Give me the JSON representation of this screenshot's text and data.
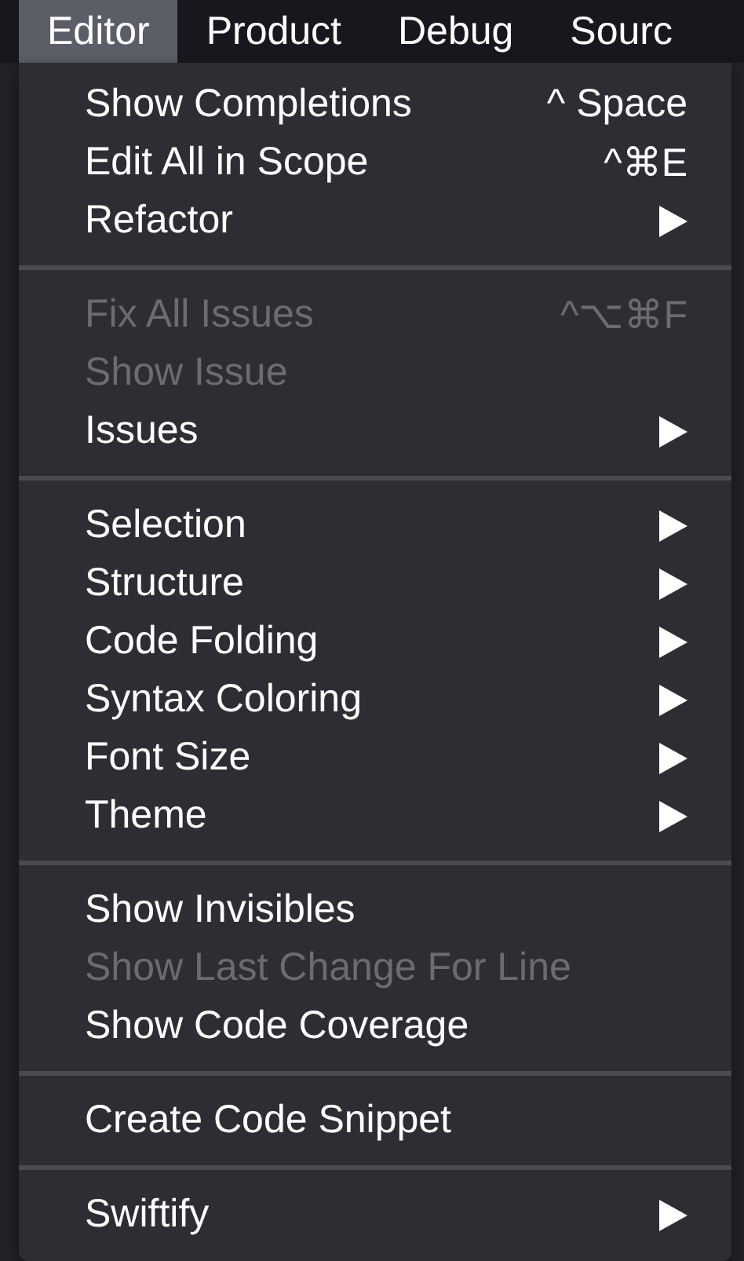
{
  "menubar": [
    {
      "label": "Editor",
      "selected": true
    },
    {
      "label": "Product",
      "selected": false
    },
    {
      "label": "Debug",
      "selected": false
    },
    {
      "label": "Sourc",
      "selected": false
    }
  ],
  "menu": {
    "groups": [
      {
        "items": [
          {
            "label": "Show Completions",
            "shortcut": "^ Space",
            "submenu": false,
            "disabled": false
          },
          {
            "label": "Edit All in Scope",
            "shortcut": "^⌘E",
            "submenu": false,
            "disabled": false
          },
          {
            "label": "Refactor",
            "submenu": true,
            "disabled": false
          }
        ]
      },
      {
        "items": [
          {
            "label": "Fix All Issues",
            "shortcut": "^⌥⌘F",
            "submenu": false,
            "disabled": true
          },
          {
            "label": "Show Issue",
            "submenu": false,
            "disabled": true
          },
          {
            "label": "Issues",
            "submenu": true,
            "disabled": false
          }
        ]
      },
      {
        "items": [
          {
            "label": "Selection",
            "submenu": true,
            "disabled": false
          },
          {
            "label": "Structure",
            "submenu": true,
            "disabled": false
          },
          {
            "label": "Code Folding",
            "submenu": true,
            "disabled": false
          },
          {
            "label": "Syntax Coloring",
            "submenu": true,
            "disabled": false
          },
          {
            "label": "Font Size",
            "submenu": true,
            "disabled": false
          },
          {
            "label": "Theme",
            "submenu": true,
            "disabled": false
          }
        ]
      },
      {
        "items": [
          {
            "label": "Show Invisibles",
            "submenu": false,
            "disabled": false
          },
          {
            "label": "Show Last Change For Line",
            "submenu": false,
            "disabled": true
          },
          {
            "label": "Show Code Coverage",
            "submenu": false,
            "disabled": false
          }
        ]
      },
      {
        "items": [
          {
            "label": "Create Code Snippet",
            "submenu": false,
            "disabled": false
          }
        ]
      },
      {
        "items": [
          {
            "label": "Swiftify",
            "submenu": true,
            "disabled": false
          }
        ]
      }
    ]
  }
}
